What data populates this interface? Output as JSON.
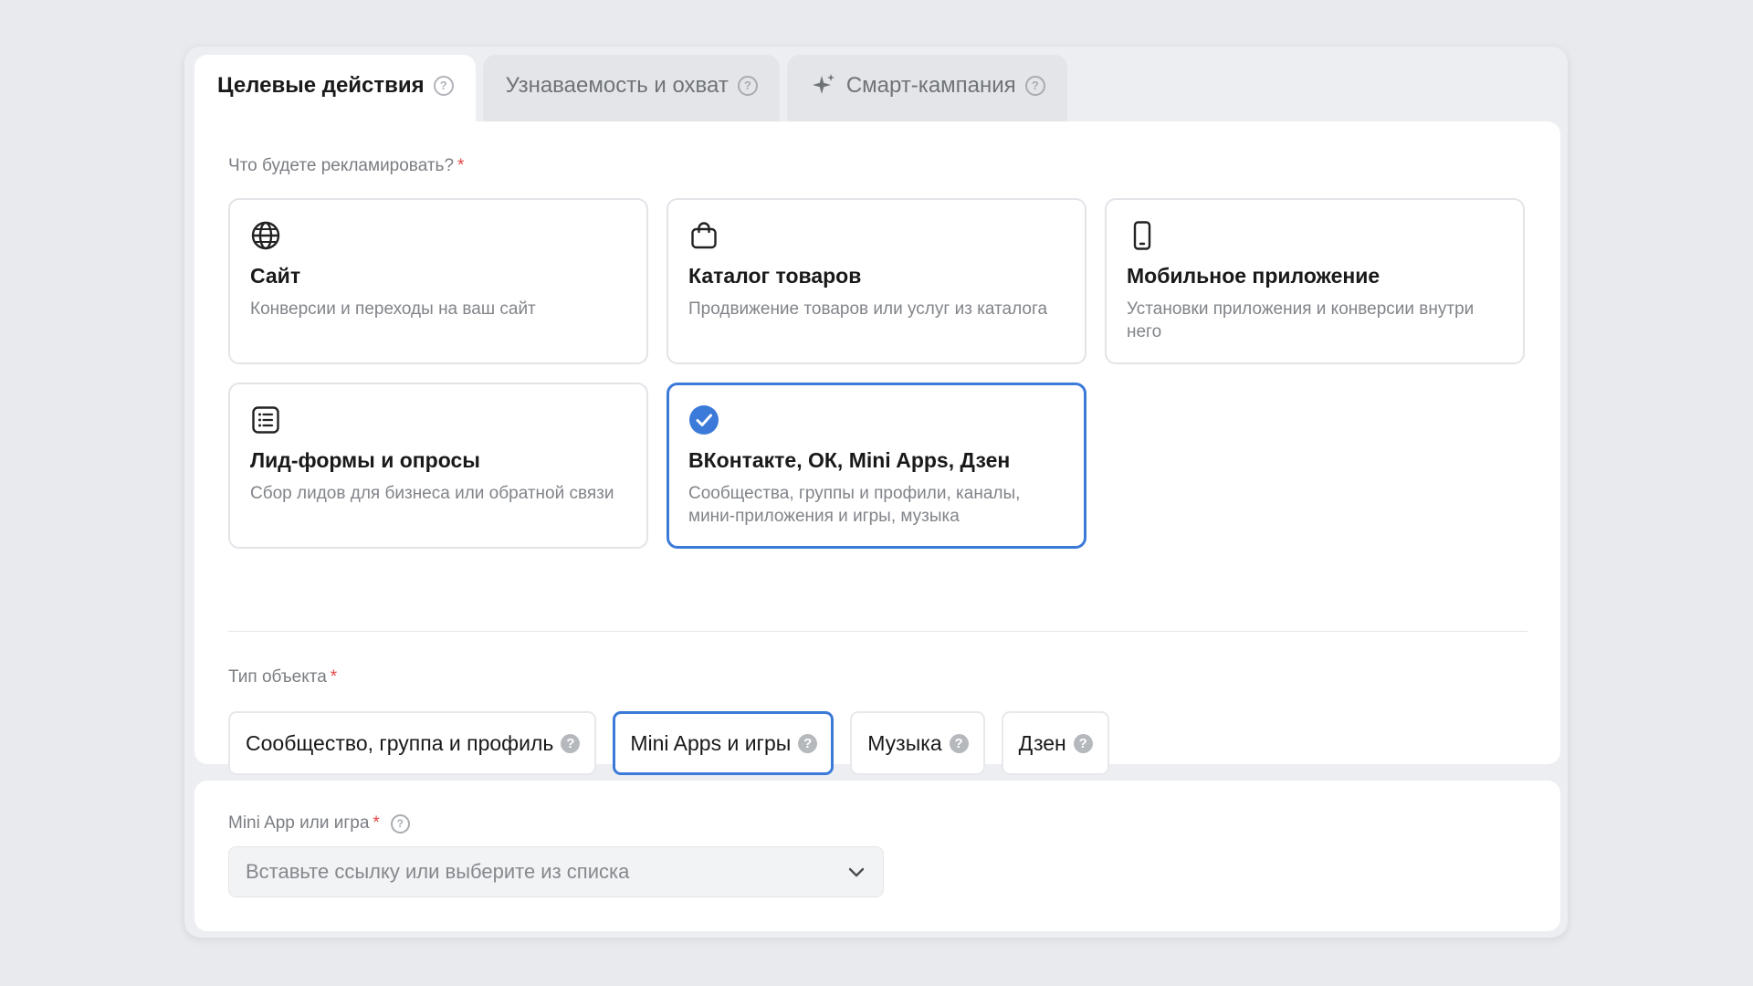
{
  "tabs": [
    {
      "label": "Целевые действия",
      "active": true,
      "icon": "question-icon"
    },
    {
      "label": "Узнаваемость и охват",
      "active": false,
      "icon": "question-icon"
    },
    {
      "label": "Смарт-кампания",
      "active": false,
      "icon": "question-icon",
      "prefix_icon": "sparkle-icon"
    }
  ],
  "advertise": {
    "label": "Что будете рекламировать?",
    "required_mark": "*",
    "options": [
      {
        "title": "Сайт",
        "description": "Конверсии и переходы на ваш сайт",
        "icon": "globe-icon",
        "selected": false
      },
      {
        "title": "Каталог товаров",
        "description": "Продвижение товаров или услуг из каталога",
        "icon": "shopping-bag-icon",
        "selected": false
      },
      {
        "title": "Мобильное приложение",
        "description": "Установки приложения и конверсии внутри него",
        "icon": "mobile-phone-icon",
        "selected": false
      },
      {
        "title": "Лид-формы и опросы",
        "description": "Сбор лидов для бизнеса или обратной связи",
        "icon": "list-form-icon",
        "selected": false
      },
      {
        "title": "ВКонтакте, ОК, Mini Apps, Дзен",
        "description": "Сообщества, группы и профили, каналы, мини-приложения и игры, музыка",
        "icon": "check-circle-icon",
        "selected": true
      }
    ]
  },
  "object_type": {
    "label": "Тип объекта",
    "required_mark": "*",
    "options": [
      {
        "label": "Сообщество, группа и профиль",
        "selected": false
      },
      {
        "label": "Mini Apps и игры",
        "selected": true
      },
      {
        "label": "Музыка",
        "selected": false
      },
      {
        "label": "Дзен",
        "selected": false
      }
    ],
    "help_glyph": "?"
  },
  "mini_app": {
    "label": "Mini App или игра",
    "required_mark": "*",
    "placeholder": "Вставьте ссылку или выберите из списка",
    "dropdown_icon": "chevron-down-icon"
  },
  "colors": {
    "accent": "#3b7ad8",
    "required": "#e64646",
    "page_bg": "#e9eaee"
  }
}
